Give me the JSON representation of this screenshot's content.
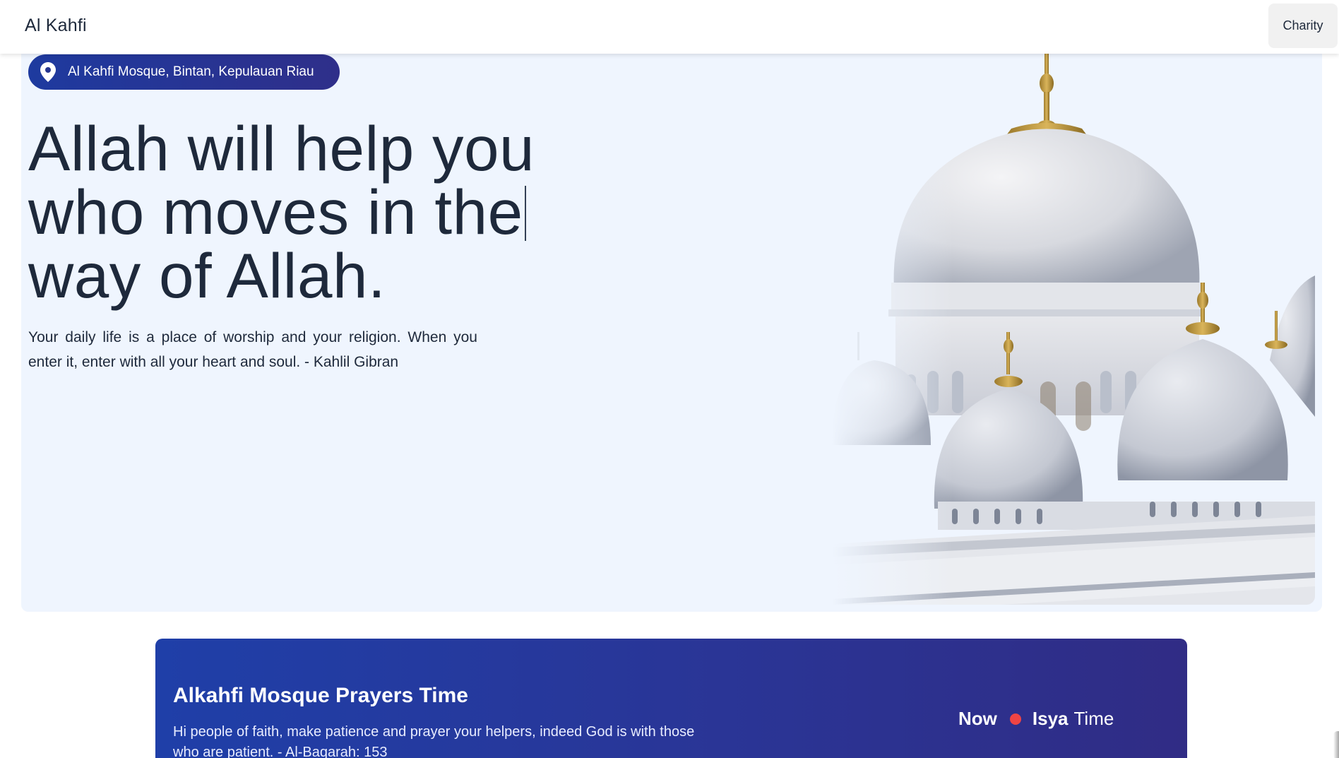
{
  "navbar": {
    "brand": "Al Kahfi",
    "charity_label": "Charity"
  },
  "hero": {
    "location": "Al Kahfi Mosque, Bintan, Kepulauan Riau",
    "location_icon": "map-pin-icon",
    "headline_lines": [
      "Allah will help you",
      "who moves in the",
      "way of Allah."
    ],
    "quote": "Your daily life is a place of worship and your religion. When you enter it, enter with all your heart and soul. - Kahlil Gibran",
    "image_subject": "mosque-domes-image"
  },
  "prayer": {
    "title": "Alkahfi Mosque Prayers Time",
    "description": "Hi people of faith, make patience and prayer your helpers, indeed God is with those who are patient. - Al-Baqarah: 153",
    "now_label": "Now",
    "current_prayer": "Isya",
    "time_word": "Time",
    "status_color": "#ef4444"
  },
  "colors": {
    "hero_background": "#eff5fe",
    "accent_start": "#1e3a9f",
    "accent_end": "#302c85",
    "text": "#1e293b"
  }
}
